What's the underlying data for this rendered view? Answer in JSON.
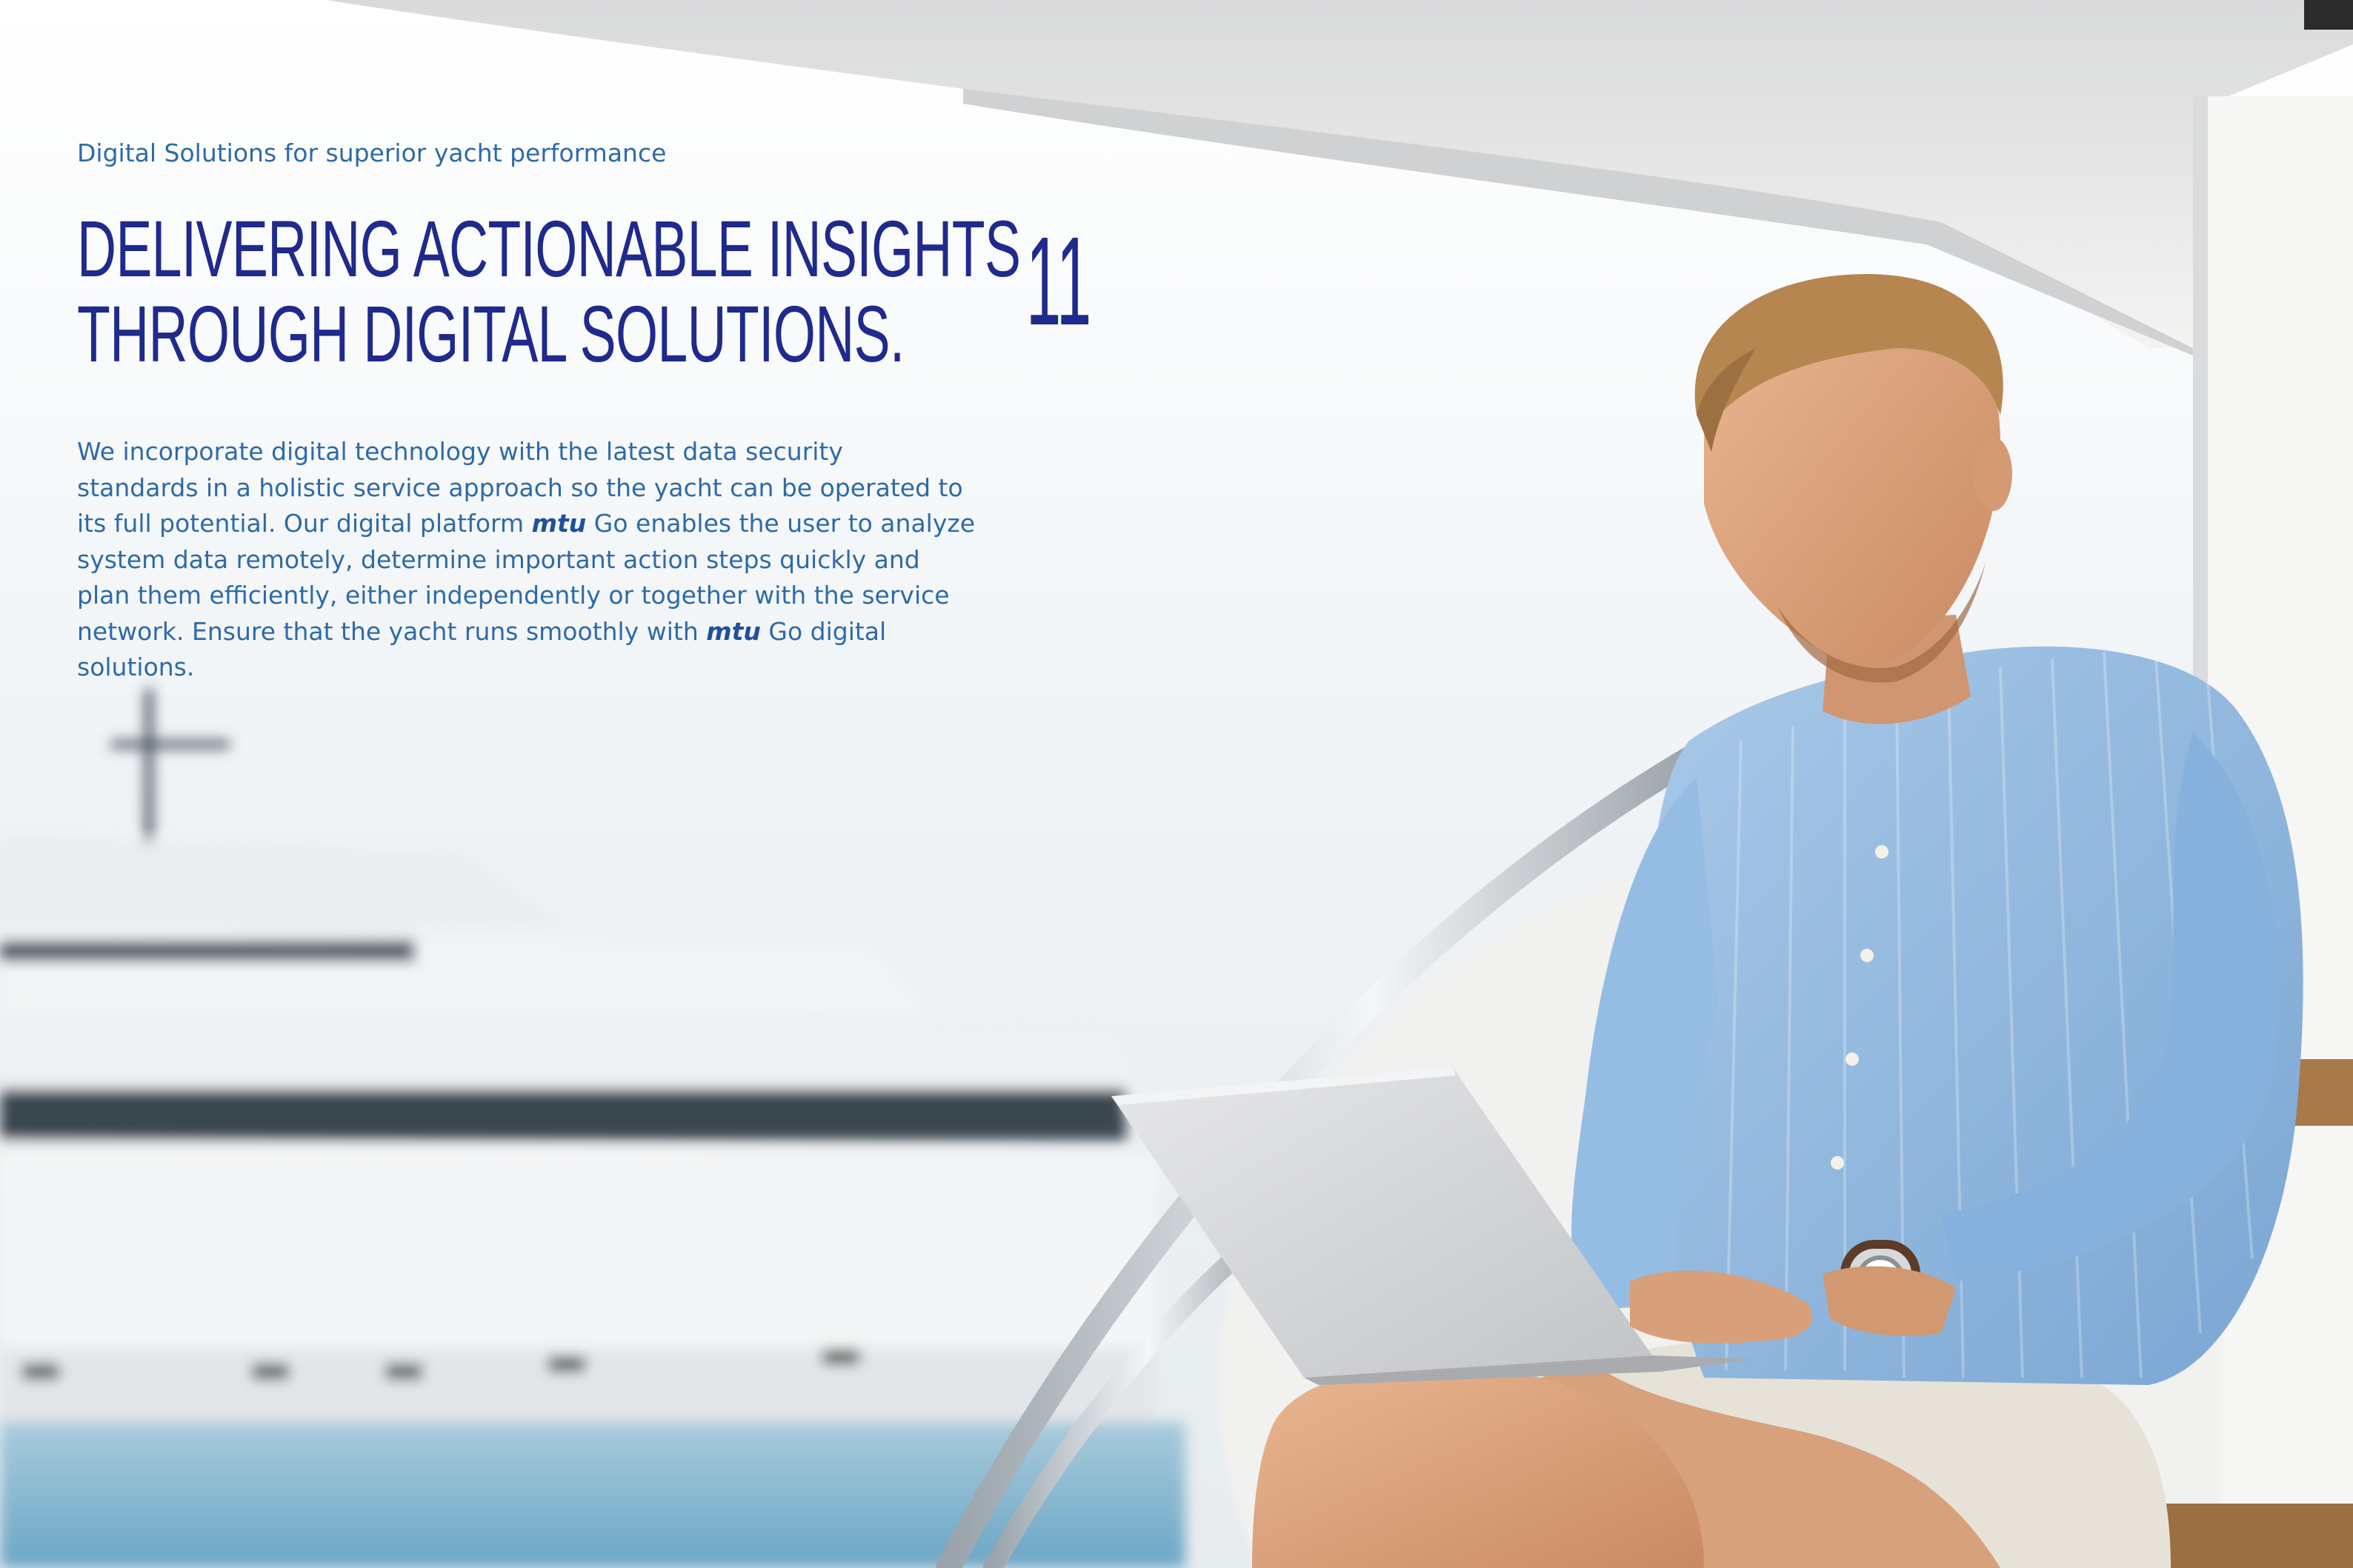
{
  "subtitle": "Digital Solutions for superior yacht performance",
  "headline": {
    "line1": "DELIVERING ACTIONABLE INSIGHTS",
    "line2": "THROUGH DIGITAL SOLUTIONS."
  },
  "page_number": "11",
  "body": {
    "l1": "We incorporate digital technology with the latest data security",
    "l2": "standards in a holistic service approach so the yacht can be operated to",
    "l3_a": "its full potential. Our digital platform ",
    "l3_brand": "mtu",
    "l3_b": " Go enables the user to analyze",
    "l4": "system data remotely, determine important action steps quickly and",
    "l5": "plan them efficiently, either independently or together with the service",
    "l6_a": "network. Ensure that the yacht runs smoothly with ",
    "l6_brand": "mtu",
    "l6_b": " Go digital",
    "l7": "solutions."
  },
  "photo": {
    "subject": "man-with-laptop-on-yacht",
    "colors": {
      "sky": "#eef3f6",
      "shirt": "#8fb8df",
      "shorts": "#e4e0d6",
      "laptop": "#d8d9db",
      "deck": "#a87a4c",
      "water": "#8fbdd4"
    }
  },
  "colors": {
    "heading": "#1f2a8c",
    "body": "#2e6aa6",
    "brand": "#1f4f9e"
  }
}
